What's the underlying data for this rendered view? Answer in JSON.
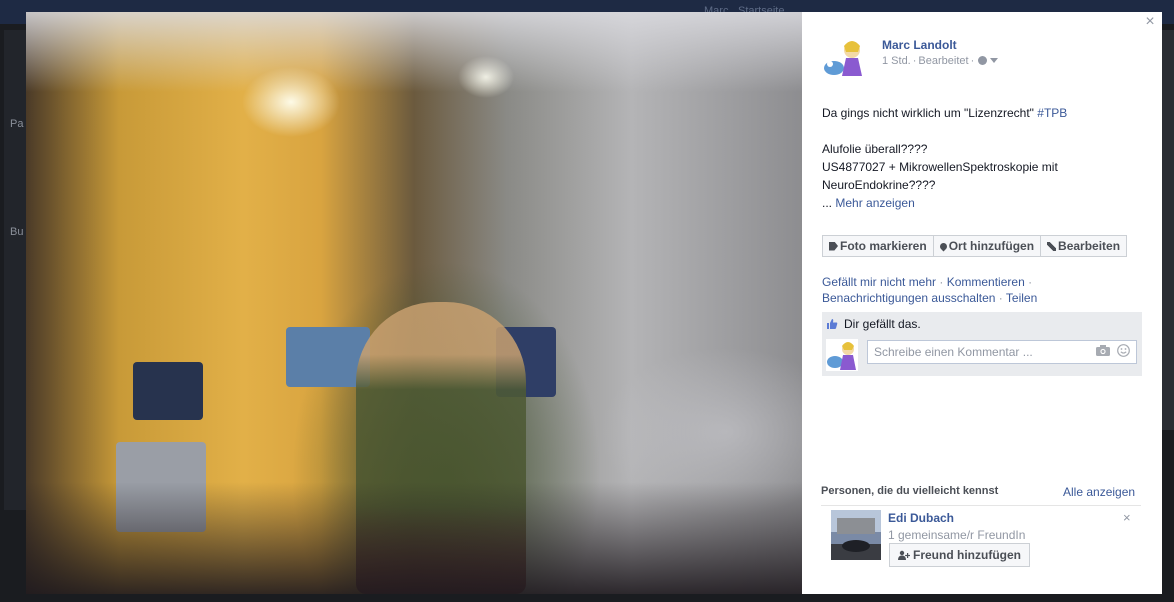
{
  "background": {
    "top_fragments": [
      "Marc",
      "Startseite"
    ],
    "side_fragments": [
      "Pa",
      "Bu"
    ]
  },
  "viewer": {
    "close_label": "×"
  },
  "post": {
    "author": "Marc Landolt",
    "time": "1 Std.",
    "edited_label": "Bearbeitet",
    "caption_line1": "Da gings nicht wirklich um \"Lizenzrecht\"",
    "hashtag": "#TPB",
    "caption_line2": "Alufolie überall????",
    "caption_line3": "US4877027 + MikrowellenSpektroskopie mit",
    "caption_line4": "NeuroEndokrine????",
    "ellipsis": "...",
    "more_label": "Mehr anzeigen"
  },
  "actions": {
    "tag_photo": "Foto markieren",
    "add_location": "Ort hinzufügen",
    "edit": "Bearbeiten"
  },
  "links": {
    "unlike": "Gefällt mir nicht mehr",
    "comment": "Kommentieren",
    "notifications_off": "Benachrichtigungen ausschalten",
    "share": "Teilen"
  },
  "likes": {
    "text": "Dir gefällt das."
  },
  "comment": {
    "placeholder": "Schreibe einen Kommentar ..."
  },
  "pymk": {
    "title": "Personen, die du vielleicht kennst",
    "see_all": "Alle anzeigen",
    "person_name": "Edi Dubach",
    "mutual": "1 gemeinsame/r FreundIn",
    "add_friend": "Freund hinzufügen",
    "remove": "×"
  },
  "colors": {
    "link": "#3b5998",
    "meta": "#9197a3",
    "panel_bg": "#ffffff",
    "likes_bg": "#e9ebee"
  }
}
